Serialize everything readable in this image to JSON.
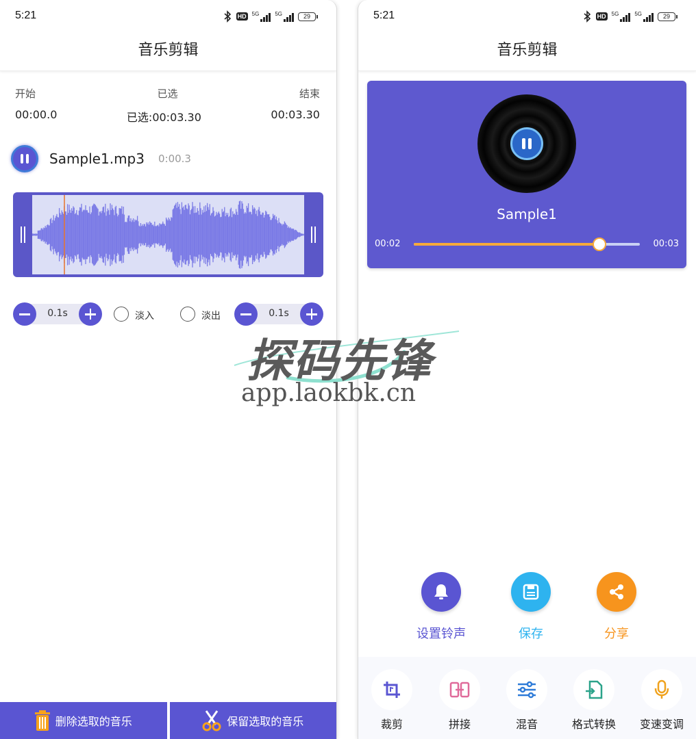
{
  "status": {
    "time": "5:21",
    "hd": "HD",
    "net1": "5G",
    "net2": "5G",
    "battery": "29"
  },
  "left": {
    "title": "音乐剪辑",
    "labels": {
      "start": "开始",
      "selected": "已选",
      "end": "结束"
    },
    "values": {
      "start": "00:00.0",
      "selected": "已选:00:03.30",
      "end": "00:03.30"
    },
    "track": {
      "name": "Sample1.mp3",
      "duration": "0:00.3"
    },
    "fade_in": {
      "label": "淡入",
      "value": "0.1s",
      "checked": false
    },
    "fade_out": {
      "label": "淡出",
      "value": "0.1s",
      "checked": false
    },
    "buttons": {
      "delete": "删除选取的音乐",
      "keep": "保留选取的音乐"
    },
    "colors": {
      "accent": "#5a55d2",
      "wave": "#7b7be6",
      "playhead": "#e8742b"
    }
  },
  "right": {
    "title": "音乐剪辑",
    "player": {
      "song": "Sample1",
      "position": "00:02",
      "length": "00:03",
      "progress": 0.82
    },
    "actions": {
      "ringtone": {
        "label": "设置铃声",
        "color": "#5a55d2"
      },
      "save": {
        "label": "保存",
        "color": "#2eb3ef"
      },
      "share": {
        "label": "分享",
        "color": "#f7941d"
      }
    },
    "tools": [
      {
        "label": "裁剪",
        "icon": "crop-icon"
      },
      {
        "label": "拼接",
        "icon": "splice-icon"
      },
      {
        "label": "混音",
        "icon": "mixer-icon"
      },
      {
        "label": "格式转换",
        "icon": "format-convert-icon"
      },
      {
        "label": "变速变调",
        "icon": "microphone-icon"
      }
    ]
  },
  "watermark": {
    "cn": "探码先锋",
    "url": "app.laokbk.cn"
  }
}
